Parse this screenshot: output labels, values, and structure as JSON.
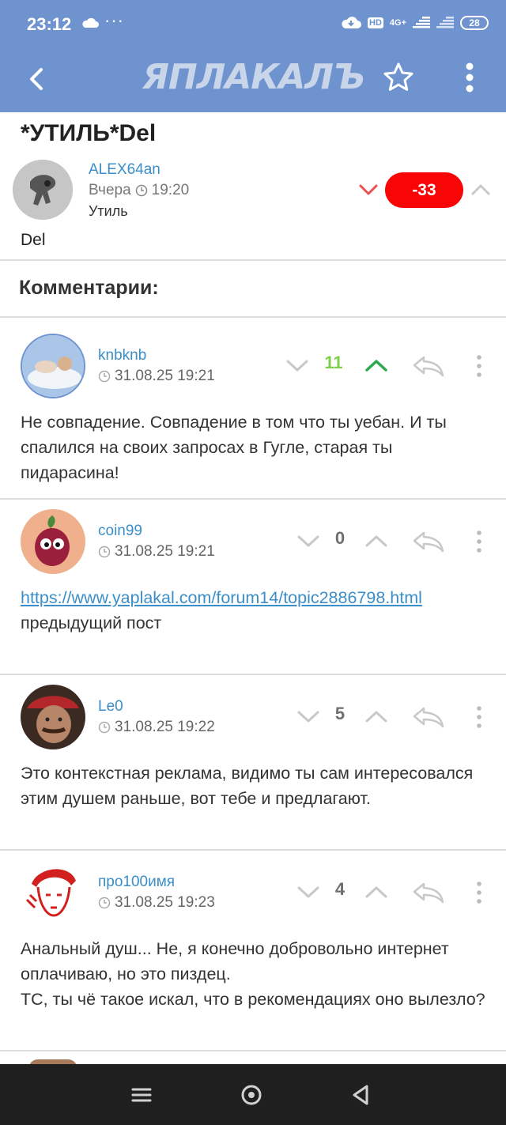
{
  "status": {
    "time": "23:12",
    "dots": "···",
    "network": "HD",
    "net_gen": "4G+",
    "battery": "28"
  },
  "appbar": {
    "logo": "ЯПЛАКАЛЪ",
    "logo_small": "Ъ"
  },
  "post": {
    "title": "*УТИЛЬ*Del",
    "author": "ALEX64an",
    "time_prefix": "Вчера",
    "time": "19:20",
    "category": "Утиль",
    "rating": "-33",
    "body": "Del"
  },
  "comments_header": "Комментарии:",
  "comments": [
    {
      "author": "knbknb",
      "time": "31.08.25 19:21",
      "rating": "11",
      "text": "Не совпадение. Совпадение в том что ты уебан. И ты спалился на своих запросах в Гугле, старая ты пидарасина!"
    },
    {
      "author": "coin99",
      "time": "31.08.25 19:21",
      "rating": "0",
      "link": "https://www.yaplakal.com/forum14/topic2886798.html",
      "text": "предыдущий пост"
    },
    {
      "author": "Le0",
      "time": "31.08.25 19:22",
      "rating": "5",
      "text": "Это контекстная реклама, видимо ты сам интересовался этим душем раньше, вот тебе и предлагают."
    },
    {
      "author": "про100имя",
      "time": "31.08.25 19:23",
      "rating": "4",
      "text": "Анальный душ... Не, я конечно добровольно интернет оплачиваю, но это пиздец.",
      "text2": "ТС, ты чё такое искал, что в рекомендациях оно вылезло?"
    }
  ],
  "colors": {
    "bar": "#6f93cf",
    "link": "#3b8ec7",
    "negative_rating": "#f90505",
    "positive_rating": "#7fcf4d",
    "upvote_active": "#2ea84f"
  },
  "icons": [
    "back-icon",
    "star-icon",
    "more-vert-icon",
    "clock-icon",
    "chevron-down-icon",
    "chevron-up-icon",
    "reply-icon",
    "menu-icon",
    "home-icon",
    "back-nav-icon"
  ]
}
